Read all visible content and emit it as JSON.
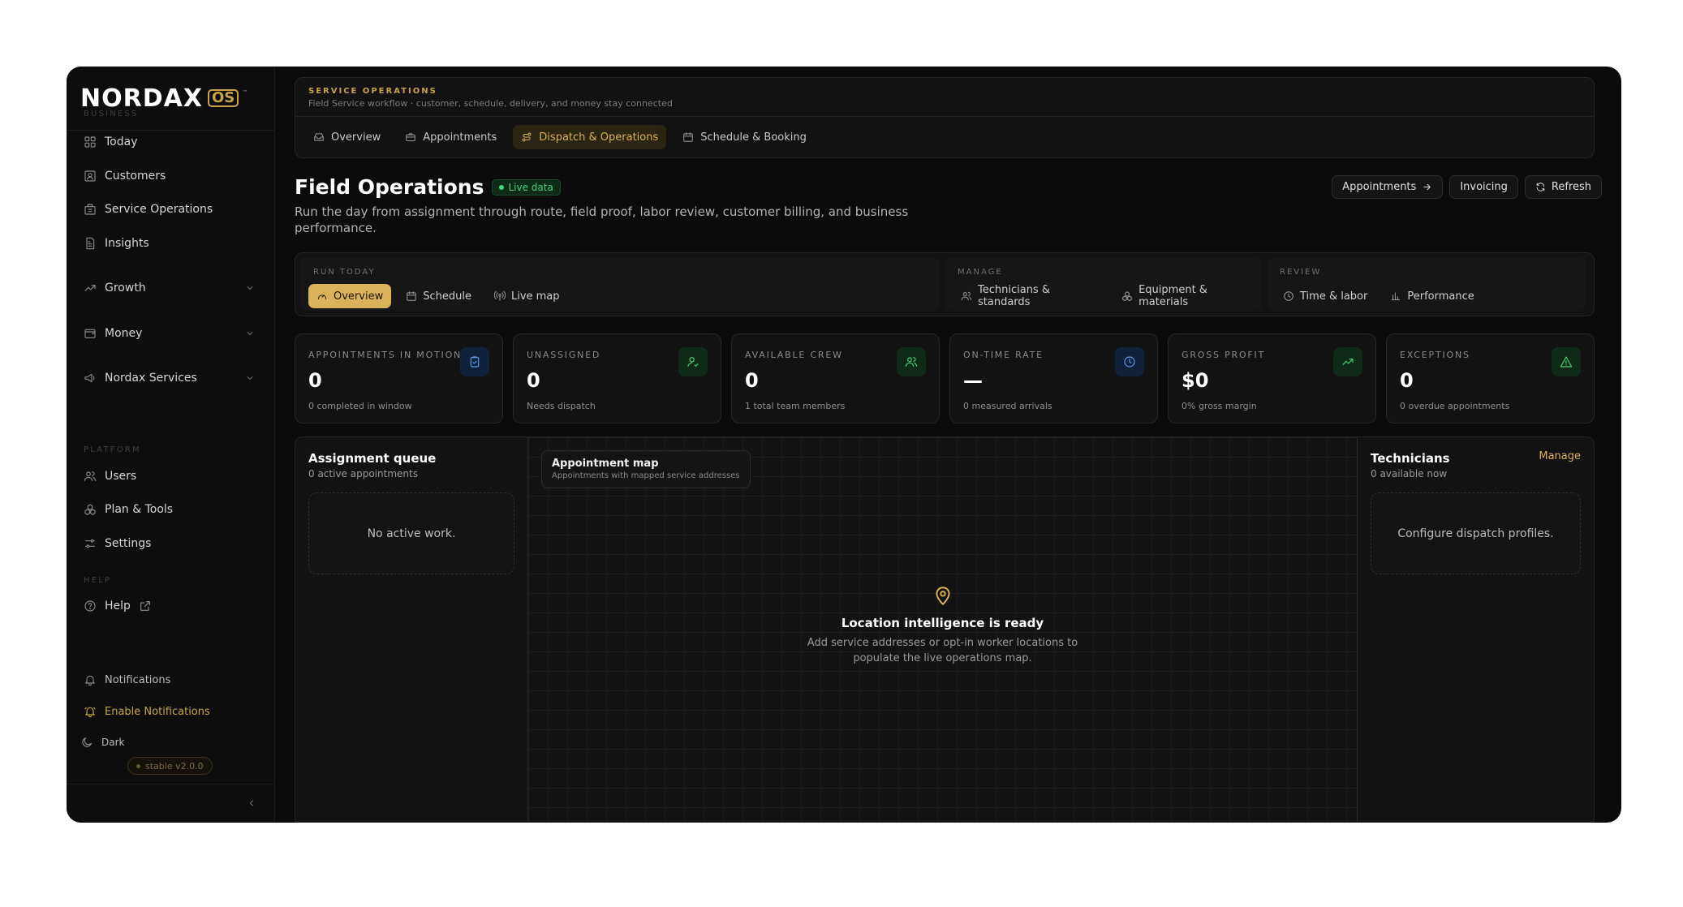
{
  "brand": {
    "name": "NORDAX",
    "suffix": "OS",
    "mark": "™"
  },
  "sidebar": {
    "sections": {
      "business": "BUSINESS",
      "platform": "PLATFORM",
      "help": "HELP"
    },
    "business_items": [
      {
        "label": "Today",
        "icon": "grid-icon"
      },
      {
        "label": "Customers",
        "icon": "contact-icon"
      },
      {
        "label": "Service Operations",
        "icon": "building-icon"
      },
      {
        "label": "Insights",
        "icon": "report-icon"
      }
    ],
    "groups": [
      {
        "label": "Growth",
        "icon": "trend-icon"
      },
      {
        "label": "Money",
        "icon": "wallet-icon"
      },
      {
        "label": "Nordax Services",
        "icon": "megaphone-icon"
      }
    ],
    "platform_items": [
      {
        "label": "Users",
        "icon": "users-icon"
      },
      {
        "label": "Plan & Tools",
        "icon": "boxes-icon"
      },
      {
        "label": "Settings",
        "icon": "sliders-icon"
      }
    ],
    "help_item": {
      "label": "Help"
    },
    "notifications": "Notifications",
    "enable_notifications": "Enable Notifications",
    "theme": "Dark",
    "version": "stable v2.0.0"
  },
  "banner": {
    "kicker": "SERVICE OPERATIONS",
    "subtitle": "Field Service workflow · customer, schedule, delivery, and money stay connected",
    "tabs": [
      {
        "label": "Overview",
        "active": false
      },
      {
        "label": "Appointments",
        "active": false
      },
      {
        "label": "Dispatch & Operations",
        "active": true
      },
      {
        "label": "Schedule & Booking",
        "active": false
      }
    ]
  },
  "header": {
    "title": "Field Operations",
    "badge": "Live data",
    "description": "Run the day from assignment through route, field proof, labor review, customer billing, and business performance.",
    "actions": {
      "appointments": "Appointments",
      "invoicing": "Invoicing",
      "refresh": "Refresh"
    }
  },
  "subnav": {
    "run_today": {
      "label": "RUN TODAY",
      "items": [
        "Overview",
        "Schedule",
        "Live map"
      ]
    },
    "manage": {
      "label": "MANAGE",
      "items": [
        "Technicians & standards",
        "Equipment & materials"
      ]
    },
    "review": {
      "label": "REVIEW",
      "items": [
        "Time & labor",
        "Performance"
      ]
    }
  },
  "kpis": [
    {
      "label": "APPOINTMENTS IN MOTION",
      "value": "0",
      "sub": "0 completed in window",
      "icon": "clipboard-icon",
      "tone": "blue"
    },
    {
      "label": "UNASSIGNED",
      "value": "0",
      "sub": "Needs dispatch",
      "icon": "user-check-icon",
      "tone": "green"
    },
    {
      "label": "AVAILABLE CREW",
      "value": "0",
      "sub": "1 total team members",
      "icon": "users-icon",
      "tone": "green"
    },
    {
      "label": "ON-TIME RATE",
      "value": "—",
      "sub": "0 measured arrivals",
      "icon": "clock-icon",
      "tone": "blue"
    },
    {
      "label": "GROSS PROFIT",
      "value": "$0",
      "sub": "0% gross margin",
      "icon": "trend-up-icon",
      "tone": "green"
    },
    {
      "label": "EXCEPTIONS",
      "value": "0",
      "sub": "0 overdue appointments",
      "icon": "alert-icon",
      "tone": "green"
    }
  ],
  "queue": {
    "title": "Assignment queue",
    "subtitle": "0 active appointments",
    "empty": "No active work."
  },
  "map": {
    "chip_title": "Appointment map",
    "chip_subtitle": "Appointments with mapped service addresses",
    "empty_title": "Location intelligence is ready",
    "empty_text": "Add service addresses or opt-in worker locations to populate the live operations map."
  },
  "technicians": {
    "title": "Technicians",
    "subtitle": "0 available now",
    "manage": "Manage",
    "empty": "Configure dispatch profiles."
  }
}
